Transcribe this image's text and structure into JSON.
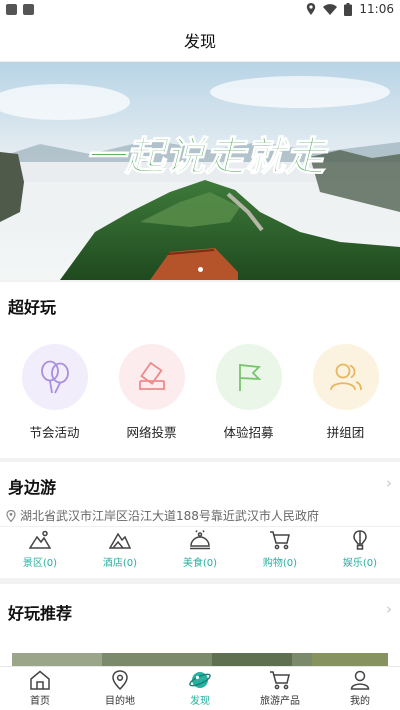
{
  "status_bar": {
    "time": "11:06",
    "icons": [
      "notification-icon",
      "sim-icon",
      "location-icon",
      "wifi-icon",
      "battery-icon"
    ]
  },
  "page": {
    "title": "发现"
  },
  "banner": {
    "slogan": "一起说走就走"
  },
  "fun": {
    "title": "超好玩",
    "items": [
      {
        "label": "节会活动",
        "icon": "balloons-icon",
        "bg": "#f1edfb",
        "color": "#a88ee0"
      },
      {
        "label": "网络投票",
        "icon": "ballot-icon",
        "bg": "#fcecee",
        "color": "#ef8a8a"
      },
      {
        "label": "体验招募",
        "icon": "flag-icon",
        "bg": "#e9f6e8",
        "color": "#78c46d"
      },
      {
        "label": "拼组团",
        "icon": "group-icon",
        "bg": "#fbf3df",
        "color": "#e7b65e"
      }
    ]
  },
  "nearby": {
    "title": "身边游",
    "address": "湖北省武汉市江岸区沿江大道188号靠近武汉市人民政府",
    "categories": [
      {
        "label": "景区(0)",
        "icon": "mountain-icon"
      },
      {
        "label": "酒店(0)",
        "icon": "hotel-icon"
      },
      {
        "label": "美食(0)",
        "icon": "food-cloche-icon"
      },
      {
        "label": "购物(0)",
        "icon": "cart-icon"
      },
      {
        "label": "娱乐(0)",
        "icon": "balloon-icon"
      }
    ]
  },
  "recommend": {
    "title": "好玩推荐"
  },
  "bottom_nav": {
    "active_color": "#27b1a0",
    "items": [
      {
        "label": "首页",
        "icon": "home-icon"
      },
      {
        "label": "目的地",
        "icon": "location-pin-icon"
      },
      {
        "label": "发现",
        "icon": "discover-planet-icon",
        "active": true
      },
      {
        "label": "旅游产品",
        "icon": "cart-icon"
      },
      {
        "label": "我的",
        "icon": "user-icon"
      }
    ]
  }
}
